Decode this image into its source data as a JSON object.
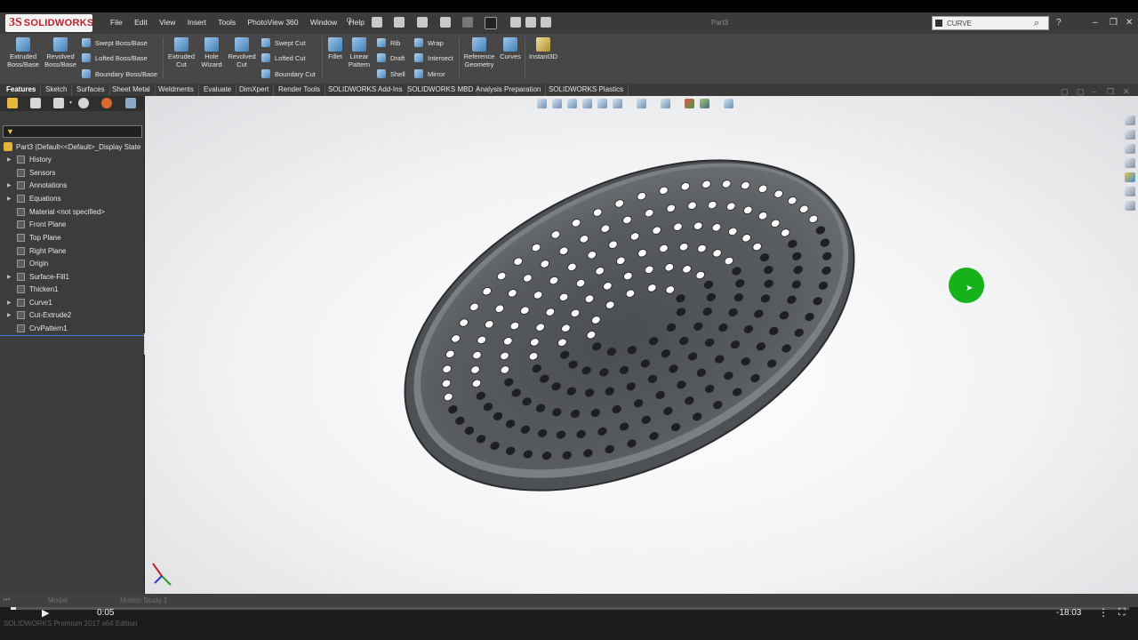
{
  "app": {
    "logo_ds": "3S",
    "logo_brand": "SOLIDWORKS",
    "menu": [
      "File",
      "Edit",
      "View",
      "Insert",
      "Tools",
      "PhotoView 360",
      "Window",
      "Help"
    ],
    "document_title": "Part3",
    "search": {
      "value": "CURVE"
    },
    "help_symbol": "?"
  },
  "ribbon": {
    "big_buttons": [
      "Extruded Boss/Base",
      "Revolved Boss/Base",
      "Extruded Cut",
      "Hole Wizard",
      "Revolved Cut",
      "Fillet",
      "Linear Pattern",
      "Reference Geometry",
      "Curves",
      "Instant3D"
    ],
    "boss_group": [
      "Swept Boss/Base",
      "Lofted Boss/Base",
      "Boundary Boss/Base"
    ],
    "cut_group": [
      "Swept Cut",
      "Lofted Cut",
      "Boundary Cut"
    ],
    "feature_group": [
      "Rib",
      "Draft",
      "Shell"
    ],
    "misc_group": [
      "Wrap",
      "Intersect",
      "Mirror"
    ]
  },
  "tabs": [
    "Features",
    "Sketch",
    "Surfaces",
    "Sheet Metal",
    "Weldments",
    "Evaluate",
    "DimXpert",
    "Render Tools",
    "SOLIDWORKS Add-Ins",
    "SOLIDWORKS MBD",
    "Analysis Preparation",
    "SOLIDWORKS Plastics"
  ],
  "tree": {
    "root": "Part3  (Default<<Default>_Display State",
    "items": [
      {
        "label": "History",
        "expandable": true
      },
      {
        "label": "Sensors",
        "expandable": false
      },
      {
        "label": "Annotations",
        "expandable": true
      },
      {
        "label": "Equations",
        "expandable": true
      },
      {
        "label": "Material <not specified>",
        "expandable": false
      },
      {
        "label": "Front Plane",
        "expandable": false
      },
      {
        "label": "Top Plane",
        "expandable": false
      },
      {
        "label": "Right Plane",
        "expandable": false
      },
      {
        "label": "Origin",
        "expandable": false
      },
      {
        "label": "Surface-Fill1",
        "expandable": true
      },
      {
        "label": "Thicken1",
        "expandable": false
      },
      {
        "label": "Curve1",
        "expandable": true
      },
      {
        "label": "Cut-Extrude2",
        "expandable": true
      },
      {
        "label": "CrvPattern1",
        "expandable": false
      }
    ]
  },
  "status": {
    "model_tab": "Model",
    "motion_tab": "Motion Study 1",
    "edition": "SOLIDWORKS Premium 2017 x64 Edition"
  },
  "player": {
    "current_time": "0:05",
    "remaining_time": "-18:03",
    "progress": 0.005
  },
  "colors": {
    "accent_red": "#c0202a",
    "click_indicator": "#17b21a"
  }
}
